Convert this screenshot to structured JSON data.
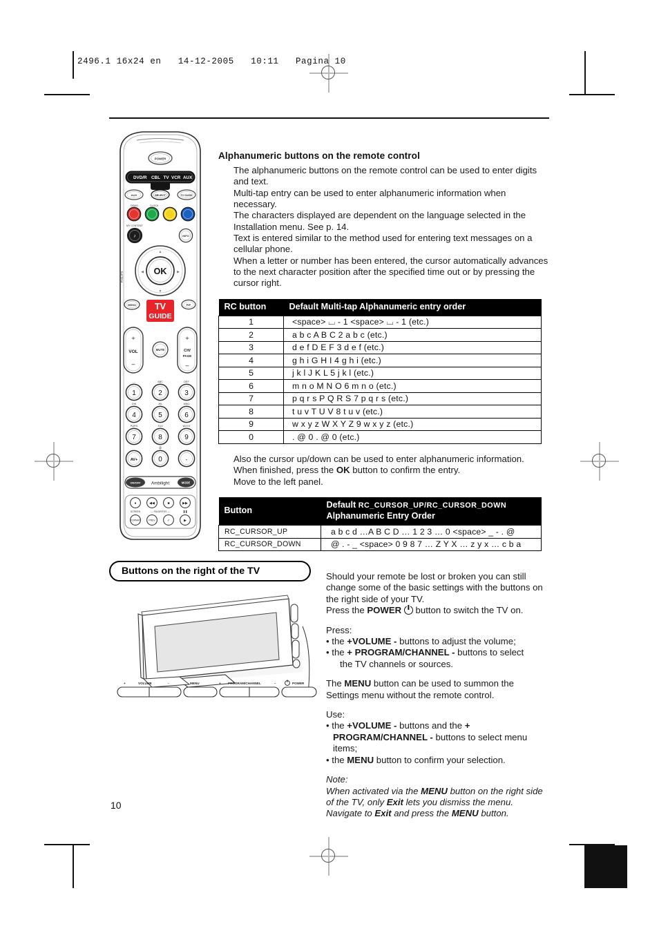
{
  "print_header": {
    "slug": "2496.1 16x24 en   14-12-2005   10:11   Pagina 10"
  },
  "page": {
    "number": "10"
  },
  "alphanumeric_section": {
    "title": "Alphanumeric buttons on the remote control",
    "paragraphs": [
      "The alphanumeric buttons on the remote control can be used to enter digits and text.",
      "Multi-tap entry can be used to enter alphanumeric information when necessary.",
      "The characters displayed are dependent on the language selected in the Installation menu. See p. 14.",
      "Text is entered similar to the method used for entering text messages on a cellular phone.",
      "When a letter or number has been entered, the cursor automatically advances to the next character position after the specified time out or by pressing the cursor right."
    ]
  },
  "multitap_table": {
    "headers": [
      "RC button",
      "Default Multi-tap Alphanumeric entry order"
    ],
    "rows": [
      {
        "key": "1",
        "value": "<space> ⌴  - 1 <space> ⌴  - 1 (etc.)"
      },
      {
        "key": "2",
        "value": "a   b   c   A   B   C  2   a   b   c    (etc.)"
      },
      {
        "key": "3",
        "value": "d   e   f   D   E   F  3   d   e   f    (etc.)"
      },
      {
        "key": "4",
        "value": "g   h   i   G  H  I   4   g   h   i    (etc.)"
      },
      {
        "key": "5",
        "value": "j   k   l   J   K  L   5   j   k   l    (etc.)"
      },
      {
        "key": "6",
        "value": "m   n   o  M  N  O  6   m   n   o    (etc.)"
      },
      {
        "key": "7",
        "value": "p   q   r   s   P   Q  R  S  7   p   q   r   s     (etc.)"
      },
      {
        "key": "8",
        "value": "t   u   v   T  U  V  8   t   u   v    (etc.)"
      },
      {
        "key": "9",
        "value": "w   x   y   z  W X  Y  Z  9   w   x   y   z    (etc.)"
      },
      {
        "key": "0",
        "value": ".   @   0 .   @    0  (etc.)"
      }
    ]
  },
  "mid_note": {
    "lines": [
      "Also the cursor up/down can be used to enter alphanumeric information.",
      "When finished, press the OK button to confirm the entry.",
      "Move to the left panel."
    ],
    "ok_label": "OK"
  },
  "cursor_table": {
    "header_key": "Button",
    "header_value_pre": "Default ",
    "header_value_mono": "RC_CURSOR_UP/RC_CURSOR_DOWN",
    "header_value_post": " Alphanumeric Entry Order",
    "rows": [
      {
        "key": "RC_CURSOR_UP",
        "value": "a   b   c   d  …A B C D … 1 2 3 … 0 <space> _  -  . @"
      },
      {
        "key": "RC_CURSOR_DOWN",
        "value": "@   .  -   _    <space> 0 9 8 7 … Z Y X … z y x … c b a"
      }
    ]
  },
  "tv_section": {
    "heading": "Buttons on the right of the TV",
    "intro_lines": [
      "Should your remote be lost or broken you can still change some of the basic settings with the buttons on the right side of your TV."
    ],
    "power_line_pre": "Press the ",
    "power_label": "POWER",
    "power_line_post": " button to switch the TV on.",
    "press_label": "Press:",
    "press_bullets": [
      {
        "pre": "the ",
        "bold": "+VOLUME -",
        "post": " buttons to adjust the volume;"
      },
      {
        "pre": "the ",
        "bold": "+ PROGRAM/CHANNEL -",
        "post": " buttons to select",
        "cont": "the TV channels or sources."
      }
    ],
    "menu_paragraph_pre": "The ",
    "menu_label": "MENU",
    "menu_paragraph_post": " button can be used to summon the Settings menu without the remote control.",
    "use_label": "Use:",
    "use_bullets": [
      {
        "pre": "the ",
        "bold": "+VOLUME -",
        "post": "  buttons and the ",
        "bold2": "+ PROGRAM/CHANNEL -",
        "post2": " buttons to select menu items;"
      },
      {
        "pre": "the ",
        "bold": "MENU",
        "post": " button to confirm your selection."
      }
    ],
    "note_title": "Note:",
    "note_lines": [
      "When activated via the MENU button on the right side of the TV, only Exit lets you dismiss the menu.",
      "Navigate to Exit and press the MENU button."
    ],
    "note_bold_menu": "MENU",
    "note_bold_exit": "Exit"
  },
  "tv_button_bar": {
    "labels": {
      "volume_plus": "+",
      "volume": "VOLUME",
      "volume_minus": "-",
      "menu": "MENU",
      "program_plus": "+",
      "program": "PROGRAM/CHANNEL",
      "program_minus": "-",
      "power": "POWER"
    }
  },
  "remote": {
    "power_label": "POWER",
    "source_bar": [
      "DVD/R",
      "CBL",
      "TV",
      "VCR",
      "AUX"
    ],
    "row_buttons": [
      "AUX",
      "SELECT",
      "TV GUIDE"
    ],
    "color_labels": {
      "red": "DEMO",
      "green": "CLOCK"
    },
    "color_keys": [
      "#e3342f",
      "#1eaa4b",
      "#f5d21c",
      "#1b5fc1"
    ],
    "mycontent_label": "MY CONTENT",
    "info_label": "INFO",
    "ok_label": "OK",
    "menu_label": "MENU",
    "pip_label": "PIP",
    "tvguide_logo_line1": "TV",
    "tvguide_logo_line2": "GUIDE",
    "vol_label": "VOL",
    "mute_label": "MUTE",
    "ch_label_1": "CH/",
    "ch_label_2": "PAGE",
    "keypad": [
      {
        "sub": "_.-",
        "digit": "1"
      },
      {
        "sub": "ABC",
        "digit": "2"
      },
      {
        "sub": "DEF",
        "digit": "3"
      },
      {
        "sub": "GHI",
        "digit": "4"
      },
      {
        "sub": "JKL",
        "digit": "5"
      },
      {
        "sub": "MNO",
        "digit": "6"
      },
      {
        "sub": "PQRS",
        "digit": "7"
      },
      {
        "sub": "TUV",
        "digit": "8"
      },
      {
        "sub": "WXYZ",
        "digit": "9"
      },
      {
        "sub": "",
        "digit": "AV+"
      },
      {
        "sub": "@",
        "digit": "0"
      },
      {
        "sub": "",
        "digit": "-"
      }
    ],
    "ambilight_row": [
      "ON/OFF",
      "Ambilight",
      "MODE"
    ],
    "media_row1": [
      "●",
      "◀◀",
      "■",
      "▶▶"
    ],
    "media_row2_labels": [
      "SCREEN FORMAT",
      "— FAVORITES —",
      "‖"
    ],
    "media_row2": [
      "FORMAT",
      "PREV",
      "✓",
      "▶"
    ],
    "side_label": "PHILIPS"
  }
}
